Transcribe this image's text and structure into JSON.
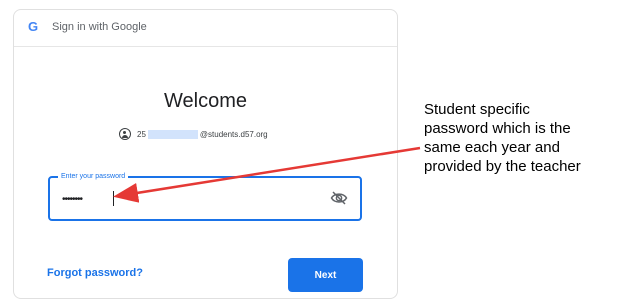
{
  "header": {
    "logo_letter": "G",
    "title": "Sign in with Google"
  },
  "signin": {
    "welcome": "Welcome",
    "account_prefix": "25",
    "account_suffix": "@students.d57.org",
    "password_label": "Enter your password",
    "password_value": "••••••••",
    "visibility_icon": "eye-off-icon",
    "forgot_label": "Forgot password?",
    "next_label": "Next"
  },
  "annotation": {
    "lines": [
      "Student specific",
      "password which is the",
      "same each year and",
      "provided by the teacher"
    ]
  },
  "colors": {
    "accent": "#1a73e8",
    "arrow": "#e53935",
    "redaction": "#d2e3fc"
  }
}
